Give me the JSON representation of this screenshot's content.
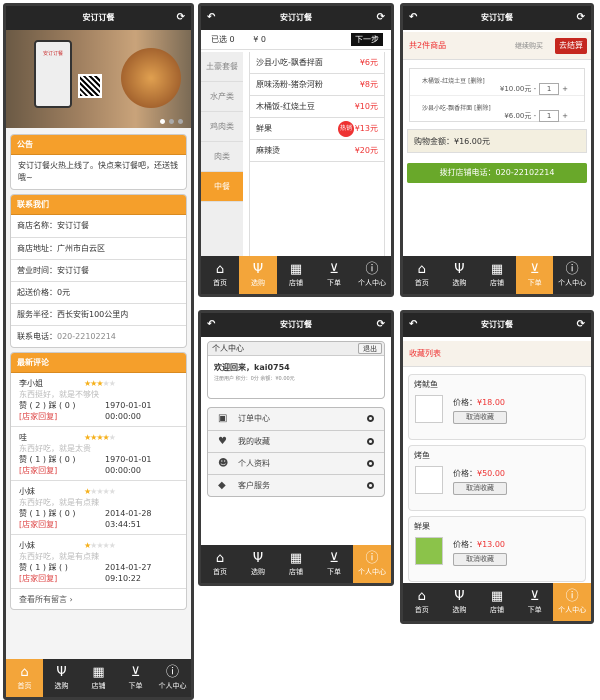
{
  "app_title": "安订订餐",
  "tabs": [
    "首页",
    "选购",
    "店铺",
    "下单",
    "个人中心"
  ],
  "home": {
    "banner_app_name": "安订订餐",
    "notice": {
      "title": "公告",
      "text": "安订订餐火热上线了。快点来订餐吧，还送钱哦~"
    },
    "contact": {
      "title": "联系我们",
      "rows": [
        "商店名称：安订订餐",
        "商店地址：广州市白云区",
        "营业时间：安订订餐",
        "起送价格：0元",
        "服务半径：西长安街100公里内"
      ],
      "phone_label": "联系电话：",
      "phone": "020-22102214"
    },
    "reviews": {
      "title": "最新评论",
      "items": [
        {
          "user": "李小姐",
          "stars": 3,
          "text": "东西挺好，就是不够快",
          "votes": "赞 ( 2 ) 踩 ( 0 )",
          "time": "1970-01-01 00:00:00",
          "reply": "[店家回复]"
        },
        {
          "user": "哇",
          "stars": 4,
          "text": "东西好吃，就是太贵",
          "votes": "赞 ( 1 ) 踩 ( 0 )",
          "time": "1970-01-01 00:00:00",
          "reply": "[店家回复]"
        },
        {
          "user": "小妹",
          "stars": 1,
          "text": "东西好吃，就是有点辣",
          "votes": "赞 ( 1 ) 踩 ( 0 )",
          "time": "2014-01-28 03:44:51",
          "reply": "[店家回复]"
        },
        {
          "user": "小妹",
          "stars": 1,
          "text": "东西好吃，就是有点辣",
          "votes": "赞 ( 1 ) 踩 (   )",
          "time": "2014-01-27 09:10:22",
          "reply": "[店家回复]"
        }
      ],
      "see_all": "查看所有留言"
    }
  },
  "shop": {
    "selected": "已选  0",
    "total": "¥  0",
    "next": "下一步",
    "categories": [
      "土豪套餐",
      "水产类",
      "鸡肉类",
      "肉类",
      "中餐"
    ],
    "active_category": 4,
    "dishes": [
      {
        "name": "沙县小吃-飘香拌面",
        "price": "¥6元",
        "hot": ""
      },
      {
        "name": "原味汤粉-猪杂河粉",
        "price": "¥8元",
        "hot": ""
      },
      {
        "name": "木桶饭-红烧土豆",
        "price": "¥10元",
        "hot": ""
      },
      {
        "name": "鲜果",
        "price": "¥13元",
        "hot": "热销"
      },
      {
        "name": "麻辣烫",
        "price": "¥20元",
        "hot": ""
      }
    ]
  },
  "cart": {
    "count_text": "共2件商品",
    "continue": "继续购买",
    "checkout": "去结算",
    "items": [
      {
        "name": "木桶饭-红烧土豆 [删除]",
        "price": "¥10.00元 -",
        "qty": "1"
      },
      {
        "name": "沙县小吃-飘香拌面 [删除]",
        "price": "¥6.00元 -",
        "qty": "1"
      }
    ],
    "amount": "购物金额：¥16.00元",
    "call": "拨打店铺电话：020-22102214"
  },
  "user": {
    "title": "个人中心",
    "logout": "退出",
    "welcome": "欢迎回来，kai0754",
    "info": "注册用户    积分：0分    余额：¥0.00元",
    "menu": [
      "订单中心",
      "我的收藏",
      "个人资料",
      "客户服务"
    ]
  },
  "favs": {
    "title": "收藏列表",
    "price_label": "价格：",
    "cancel": "取消收藏",
    "items": [
      {
        "name": "烤鱿鱼",
        "price": "¥18.00"
      },
      {
        "name": "烤鱼",
        "price": "¥50.00"
      },
      {
        "name": "鲜果",
        "price": "¥13.00"
      }
    ]
  },
  "colors": {
    "accent": "#f59f2b",
    "dark": "#262626",
    "green": "#69a82a",
    "red": "#cc2222"
  }
}
